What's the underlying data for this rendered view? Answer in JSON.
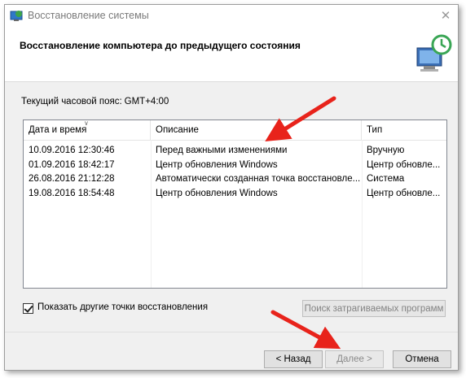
{
  "window": {
    "title": "Восстановление системы",
    "close_glyph": "✕",
    "heading": "Восстановление компьютера до предыдущего состояния"
  },
  "timezone": {
    "label": "Текущий часовой пояс:",
    "value": "GMT+4:00"
  },
  "table": {
    "columns": [
      "Дата и время",
      "Описание",
      "Тип"
    ],
    "rows": [
      {
        "date": "10.09.2016 12:30:46",
        "description": "Перед важными изменениями",
        "type": "Вручную"
      },
      {
        "date": "01.09.2016 18:42:17",
        "description": "Центр обновления Windows",
        "type": "Центр обновле..."
      },
      {
        "date": "26.08.2016 21:12:28",
        "description": "Автоматически созданная точка восстановле...",
        "type": "Система"
      },
      {
        "date": "19.08.2016 18:54:48",
        "description": "Центр обновления Windows",
        "type": "Центр обновле..."
      }
    ]
  },
  "options": {
    "show_more_label": "Показать другие точки восстановления",
    "show_more_checked": true,
    "scan_button": "Поиск затрагиваемых программ"
  },
  "buttons": {
    "back": "< Назад",
    "next": "Далее >",
    "cancel": "Отмена"
  },
  "colors": {
    "annotation_arrow": "#e8231b",
    "window_bg": "#f0f0f0"
  },
  "icons": [
    "system-restore-icon",
    "monitor-restore-icon",
    "checkbox-check-icon",
    "red-arrow-annotation"
  ]
}
